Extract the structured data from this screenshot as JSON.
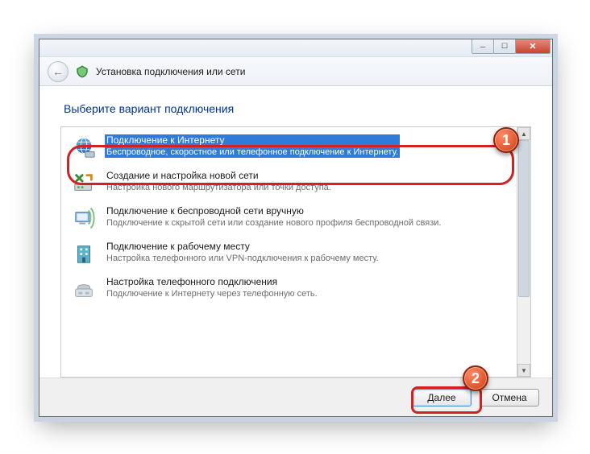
{
  "window": {
    "title": "Установка подключения или сети"
  },
  "heading": "Выберите вариант подключения",
  "options": [
    {
      "title": "Подключение к Интернету",
      "desc": "Беспроводное, скоростное или телефонное подключение к Интернету."
    },
    {
      "title": "Создание и настройка новой сети",
      "desc": "Настройка нового маршрутизатора или точки доступа."
    },
    {
      "title": "Подключение к беспроводной сети вручную",
      "desc": "Подключение к скрытой сети или создание нового профиля беспроводной связи."
    },
    {
      "title": "Подключение к рабочему месту",
      "desc": "Настройка телефонного или VPN-подключения к рабочему месту."
    },
    {
      "title": "Настройка телефонного подключения",
      "desc": "Подключение к Интернету через телефонную сеть."
    }
  ],
  "buttons": {
    "next": "Далее",
    "cancel": "Отмена"
  },
  "markers": {
    "one": "1",
    "two": "2"
  }
}
